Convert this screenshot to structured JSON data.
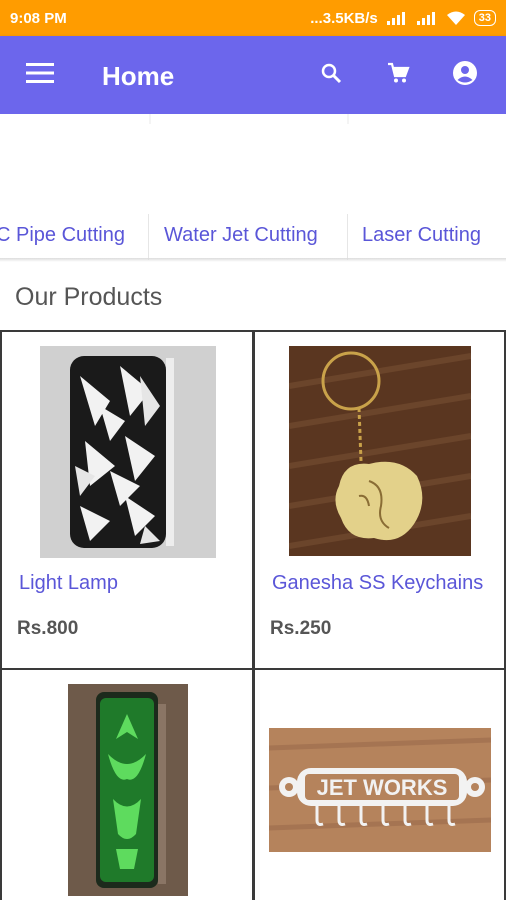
{
  "status_bar": {
    "time": "9:08 PM",
    "network_speed": "...3.5KB/s",
    "battery": "33"
  },
  "app_bar": {
    "title": "Home",
    "icons": [
      "menu-icon",
      "search-icon",
      "cart-icon",
      "account-icon"
    ]
  },
  "categories": [
    {
      "label": "C Pipe Cutting"
    },
    {
      "label": "Water Jet Cutting"
    },
    {
      "label": "Laser Cutting"
    }
  ],
  "products_section": {
    "title": "Our Products"
  },
  "products": [
    {
      "name": "Light Lamp",
      "price": "Rs.800"
    },
    {
      "name": "Ganesha SS Keychains",
      "price": "Rs.250"
    },
    {
      "name": "",
      "price": ""
    },
    {
      "name": "",
      "price": ""
    }
  ],
  "product_image_text": {
    "key_holder_sign": "JET WORKS"
  },
  "colors": {
    "status_bar": "#ff9c00",
    "app_bar": "#6c66ec",
    "accent_text": "#5a56d8"
  }
}
